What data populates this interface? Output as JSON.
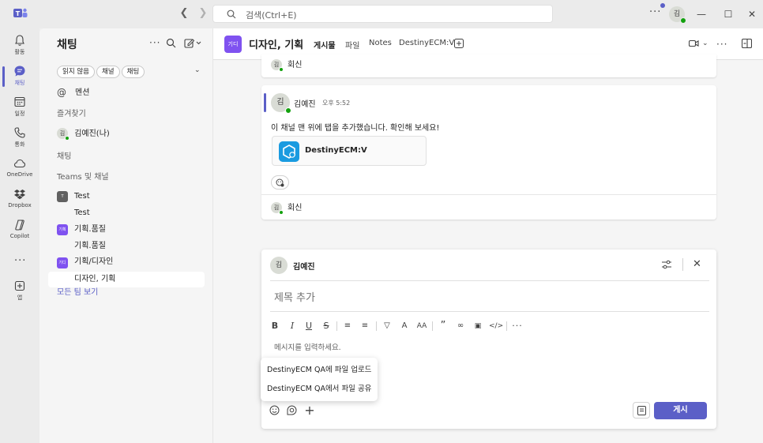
{
  "titlebar": {
    "search_placeholder": "검색(Ctrl+E)",
    "avatar_initial": "김"
  },
  "rail": {
    "items": [
      {
        "label": "활동",
        "icon": "bell-icon"
      },
      {
        "label": "채팅",
        "icon": "chat-icon",
        "active": true
      },
      {
        "label": "일정",
        "icon": "calendar-icon"
      },
      {
        "label": "통화",
        "icon": "phone-icon"
      },
      {
        "label": "OneDrive",
        "icon": "cloud-icon"
      },
      {
        "label": "Dropbox",
        "icon": "dropbox-icon"
      },
      {
        "label": "Copilot",
        "icon": "copilot-icon"
      },
      {
        "label": "앱",
        "icon": "add-app-icon"
      }
    ],
    "more": "..."
  },
  "chatlist": {
    "title": "채팅",
    "filters": [
      "읽지 않음",
      "채널",
      "채팅"
    ],
    "mentions": "멘션",
    "favorites_header": "즐겨찾기",
    "favorite_user": "김예진(나)",
    "favorite_user_initial": "김",
    "chats_header": "채팅",
    "teams_header": "Teams 및 채널",
    "teams": [
      {
        "name": "Test",
        "tile": "T",
        "channel": "Test"
      },
      {
        "name": "기획.품질",
        "tile": "기획",
        "channel": "기획.품질"
      },
      {
        "name": "기획/디자인",
        "tile": "기디",
        "channel": "디자인, 기획"
      }
    ],
    "see_all": "모든 팀 보기"
  },
  "main": {
    "channel_tile": "기디",
    "channel_title": "디자인, 기획",
    "tabs": [
      "게시물",
      "파일",
      "Notes",
      "DestinyECM:V"
    ],
    "reply_label": "회신",
    "reply_initial": "김",
    "message": {
      "author_initial": "김",
      "author": "김예진",
      "time": "오후 5:52",
      "body": "이 채널 맨 위에 탭을 추가했습니다. 확인해 보세요!",
      "app_name": "DestinyECM:V"
    }
  },
  "compose": {
    "author_initial": "김",
    "author": "김예진",
    "subject_placeholder": "제목 추가",
    "message_placeholder": "메시지를 입력하세요.",
    "post_button": "게시",
    "menu": [
      "DestinyECM QA에 파일 업로드",
      "DestinyECM QA에서 파일 공유"
    ]
  },
  "colors": {
    "accent": "#5b5fc7",
    "status_available": "#13a10e",
    "app_icon": "#1a9be0",
    "team_tile_purple": "#7f52f0",
    "team_tile_gray": "#616161"
  }
}
